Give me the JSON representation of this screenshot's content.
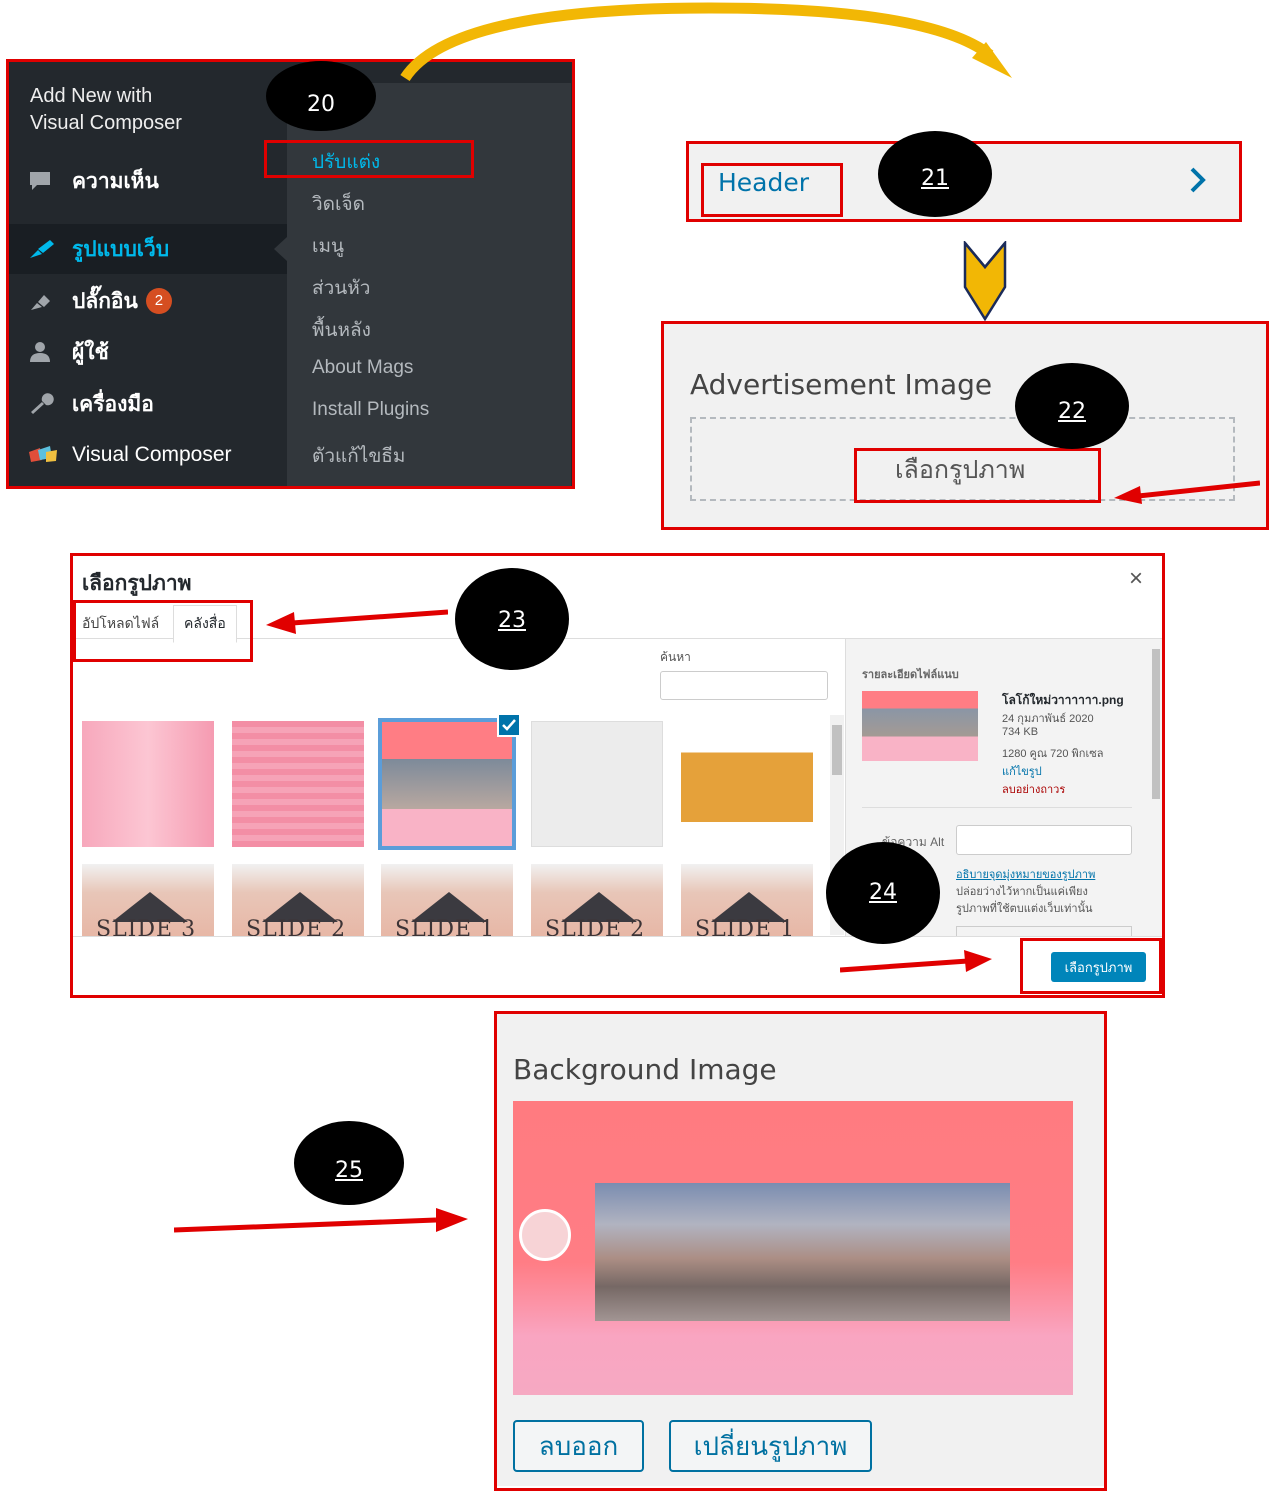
{
  "steps": [
    "20",
    "21",
    "22",
    "23",
    "24",
    "25"
  ],
  "admin_menu": {
    "top_label_line1": "Add New with",
    "top_label_line2": "Visual Composer",
    "items": [
      {
        "label": "ความเห็น",
        "icon": "comment-icon"
      },
      {
        "label": "รูปแบบเว็บ",
        "icon": "paintbrush-icon",
        "active": true
      },
      {
        "label": "ปลั๊กอิน",
        "icon": "plugin-icon",
        "badge": "2"
      },
      {
        "label": "ผู้ใช้",
        "icon": "user-icon"
      },
      {
        "label": "เครื่องมือ",
        "icon": "wrench-icon"
      },
      {
        "label": "Visual Composer",
        "icon": "visual-composer-icon"
      }
    ],
    "submenu": [
      "ปรับแต่ง",
      "วิดเจ็ด",
      "เมนู",
      "ส่วนหัว",
      "พื้นหลัง",
      "About Mags",
      "Install Plugins",
      "ตัวแก้ไขธีม"
    ]
  },
  "customizer": {
    "section_label": "Header",
    "ad_title": "Advertisement Image",
    "select_image_label": "เลือกรูปภาพ"
  },
  "media_modal": {
    "title": "เลือกรูปภาพ",
    "tabs": [
      "อัปโหลดไฟล์",
      "คลังสื่อ"
    ],
    "search_label": "ค้นหา",
    "search_value": "",
    "slides": [
      "SLIDE 3",
      "SLIDE 2",
      "SLIDE 1",
      "SLIDE 2",
      "SLIDE 1"
    ],
    "details": {
      "heading": "รายละเอียดไฟล์แนบ",
      "filename": "โลโก้ใหม่วาาาาาา.png",
      "date": "24 กุมภาพันธ์ 2020",
      "size": "734 KB",
      "dimensions": "1280 คูณ 720 พิกเซล",
      "edit_link": "แก้ไขรูป",
      "delete_link": "ลบอย่างถาวร",
      "alt_label": "ข้อความ Alt",
      "alt_value": "",
      "alt_help_link": "อธิบายจุดมุ่งหมายของรูปภาพ",
      "alt_help_line1": "ปล่อยว่างไว้หากเป็นแค่เพียง",
      "alt_help_line2": "รูปภาพที่ใช้ตบแต่งเว็บเท่านั้น"
    },
    "select_button": "เลือกรูปภาพ",
    "close_icon": "×"
  },
  "background_panel": {
    "title": "Background Image",
    "remove_button": "ลบออก",
    "change_button": "เปลี่ยนรูปภาพ"
  },
  "colors": {
    "highlight": "#e00000",
    "wp_dark": "#23282d",
    "wp_blue": "#0073aa",
    "pink": "#ff8087"
  }
}
